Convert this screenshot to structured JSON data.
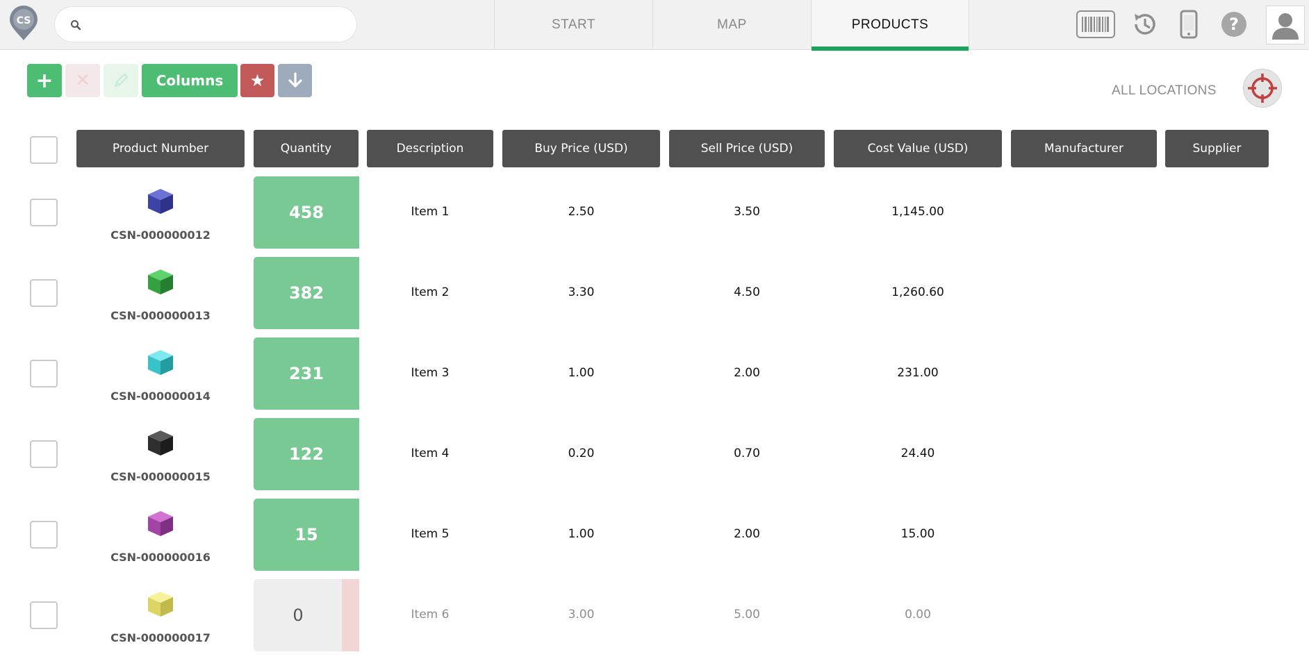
{
  "app": {
    "logo_text": "CS"
  },
  "search": {
    "value": "",
    "placeholder": ""
  },
  "nav": {
    "tabs": [
      {
        "label": "START"
      },
      {
        "label": "MAP"
      },
      {
        "label": "PRODUCTS",
        "active": true
      }
    ]
  },
  "header_icons": [
    "barcode-scanner-icon",
    "history-icon",
    "mobile-device-icon",
    "help-icon",
    "user-avatar-icon"
  ],
  "toolbar": {
    "add_icon": "+",
    "delete_icon": "✕",
    "columns_label": "Columns",
    "favorite_icon": "★"
  },
  "location": {
    "label": "ALL LOCATIONS"
  },
  "table": {
    "headers": [
      "Product Number",
      "Quantity",
      "Description",
      "Buy Price (USD)",
      "Sell Price (USD)",
      "Cost Value (USD)",
      "Manufacturer",
      "Supplier"
    ],
    "rows": [
      {
        "product_number": "CSN-000000012",
        "cube_color": "#4a4fb8",
        "quantity": "458",
        "description": "Item 1",
        "buy_price": "2.50",
        "sell_price": "3.50",
        "cost_value": "1,145.00",
        "manufacturer": "",
        "supplier": "",
        "in_stock": true
      },
      {
        "product_number": "CSN-000000013",
        "cube_color": "#3aa84a",
        "quantity": "382",
        "description": "Item 2",
        "buy_price": "3.30",
        "sell_price": "4.50",
        "cost_value": "1,260.60",
        "manufacturer": "",
        "supplier": "",
        "in_stock": true
      },
      {
        "product_number": "CSN-000000014",
        "cube_color": "#3fc9cf",
        "quantity": "231",
        "description": "Item 3",
        "buy_price": "1.00",
        "sell_price": "2.00",
        "cost_value": "231.00",
        "manufacturer": "",
        "supplier": "",
        "in_stock": true
      },
      {
        "product_number": "CSN-000000015",
        "cube_color": "#333333",
        "quantity": "122",
        "description": "Item 4",
        "buy_price": "0.20",
        "sell_price": "0.70",
        "cost_value": "24.40",
        "manufacturer": "",
        "supplier": "",
        "in_stock": true
      },
      {
        "product_number": "CSN-000000016",
        "cube_color": "#a84aab",
        "quantity": "15",
        "description": "Item 5",
        "buy_price": "1.00",
        "sell_price": "2.00",
        "cost_value": "15.00",
        "manufacturer": "",
        "supplier": "",
        "in_stock": true
      },
      {
        "product_number": "CSN-000000017",
        "cube_color": "#e4df6c",
        "quantity": "0",
        "description": "Item 6",
        "buy_price": "3.00",
        "sell_price": "5.00",
        "cost_value": "0.00",
        "manufacturer": "",
        "supplier": "",
        "in_stock": false
      }
    ]
  },
  "colors": {
    "accent_green": "#4cbd72",
    "qty_green": "#79c995",
    "header_dark": "#505050",
    "favorite_red": "#c25a5a",
    "download_gray_blue": "#9dabbd",
    "active_tab_underline": "#1aa35a"
  }
}
